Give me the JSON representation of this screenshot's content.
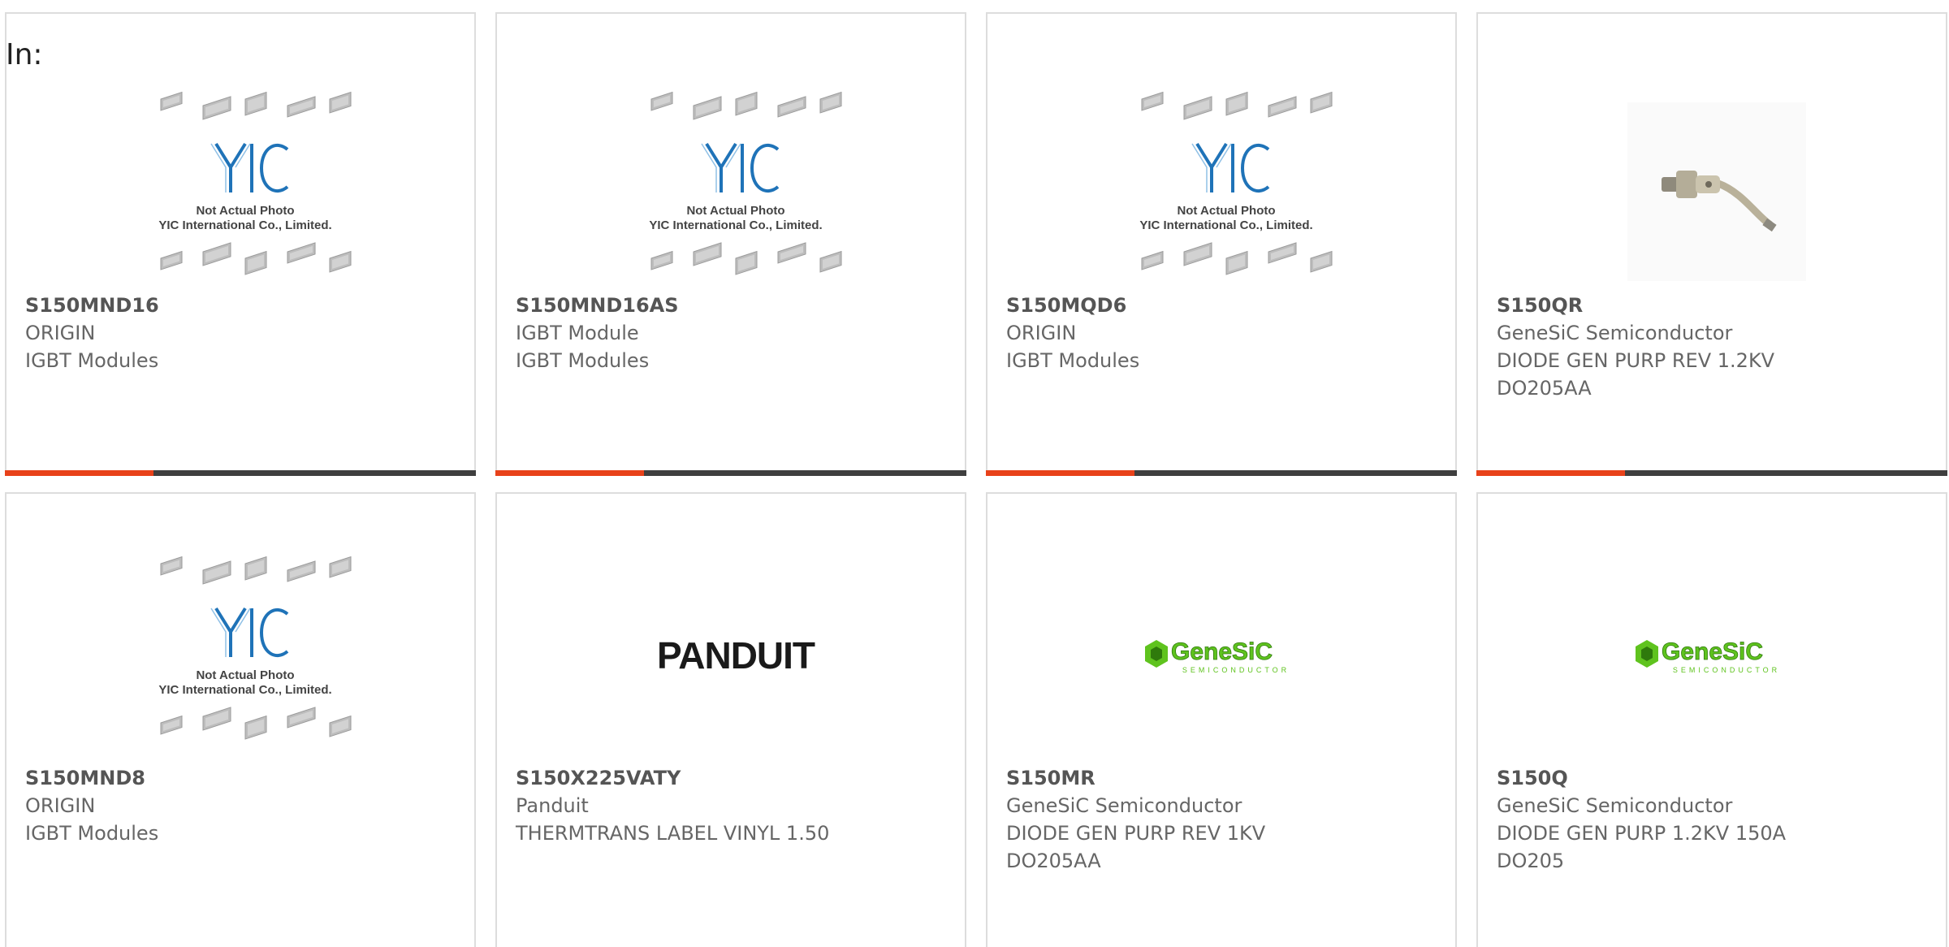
{
  "filter_label": "In:",
  "colors": {
    "accent": "#e8421a",
    "bar": "#3f3f3f",
    "genesic_green": "#5fc31e",
    "yic_blue": "#1f73b8"
  },
  "placeholder_caption": {
    "line1": "Not Actual Photo",
    "line2": "YIC International Co., Limited."
  },
  "brand_logos": {
    "panduit": "PANDUIT",
    "genesic": "GeneSiC",
    "genesic_sub": "SEMICONDUCTOR"
  },
  "products": [
    {
      "part_number": "S150MND16",
      "manufacturer": "ORIGIN",
      "description": "IGBT Modules",
      "image": "yic-placeholder",
      "row": 0,
      "col": 0
    },
    {
      "part_number": "S150MND16AS",
      "manufacturer": "IGBT Module",
      "description": "IGBT Modules",
      "image": "yic-placeholder",
      "row": 0,
      "col": 1
    },
    {
      "part_number": "S150MQD6",
      "manufacturer": "ORIGIN",
      "description": "IGBT Modules",
      "image": "yic-placeholder",
      "row": 0,
      "col": 2
    },
    {
      "part_number": "S150QR",
      "manufacturer": "GeneSiC Semiconductor",
      "description": "DIODE GEN PURP REV 1.2KV\nDO205AA",
      "image": "stud-diode-photo",
      "row": 0,
      "col": 3
    },
    {
      "part_number": "S150MND8",
      "manufacturer": "ORIGIN",
      "description": "IGBT Modules",
      "image": "yic-placeholder",
      "row": 1,
      "col": 0
    },
    {
      "part_number": "S150X225VATY",
      "manufacturer": "Panduit",
      "description": "THERMTRANS LABEL VINYL 1.50",
      "image": "panduit-logo",
      "row": 1,
      "col": 1
    },
    {
      "part_number": "S150MR",
      "manufacturer": "GeneSiC Semiconductor",
      "description": "DIODE GEN PURP REV 1KV\nDO205AA",
      "image": "genesic-logo",
      "row": 1,
      "col": 2
    },
    {
      "part_number": "S150Q",
      "manufacturer": "GeneSiC Semiconductor",
      "description": "DIODE GEN PURP 1.2KV 150A\nDO205",
      "image": "genesic-logo",
      "row": 1,
      "col": 3
    }
  ]
}
